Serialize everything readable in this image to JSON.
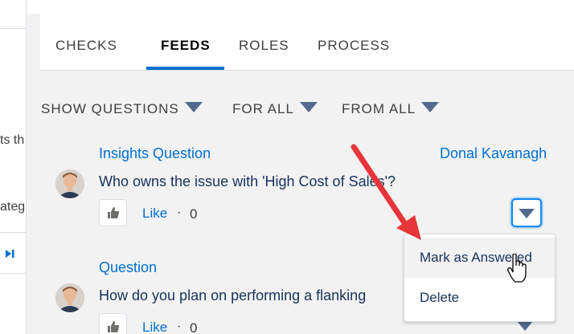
{
  "left_panel": {
    "fragments": [
      "ts th",
      "ateg"
    ]
  },
  "tabs": [
    {
      "label": "CHECKS",
      "active": false
    },
    {
      "label": "FEEDS",
      "active": true
    },
    {
      "label": "ROLES",
      "active": false
    },
    {
      "label": "PROCESS",
      "active": false
    }
  ],
  "filters": {
    "show": "SHOW QUESTIONS",
    "for": "FOR ALL",
    "from": "FROM ALL"
  },
  "feeds": [
    {
      "type": "Insights Question",
      "author": "Donal Kavanagh",
      "question": "Who owns the issue with 'High Cost of Sales'?",
      "like_label": "Like",
      "separator": "·",
      "like_count": "0"
    },
    {
      "type": "Question",
      "author": "",
      "question": "How do you plan on performing a flanking",
      "like_label": "Like",
      "separator": "·",
      "like_count": "0"
    }
  ],
  "dropdown": {
    "items": [
      "Mark as Answered",
      "Delete"
    ]
  },
  "colors": {
    "link": "#0070d2",
    "annotation_arrow": "#e8353a",
    "active_tab_underline": "#0070d2"
  },
  "icons": {
    "like": "thumbs-up-icon",
    "menu": "chevron-down-icon",
    "nav": "skip-forward-icon",
    "cursor": "hand-pointer-icon"
  }
}
